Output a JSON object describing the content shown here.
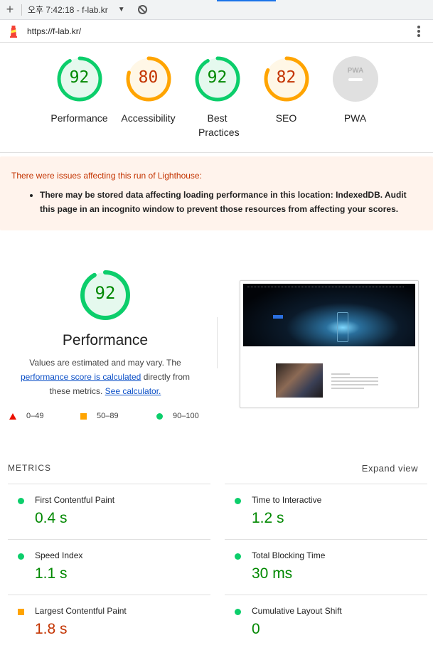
{
  "browser": {
    "tab_title": "오후 7:42:18 - f-lab.kr",
    "url": "https://f-lab.kr/"
  },
  "categories": [
    {
      "label": "Performance",
      "score": "92",
      "status": "pass",
      "fraction": 0.92
    },
    {
      "label": "Accessibility",
      "score": "80",
      "status": "average",
      "fraction": 0.8
    },
    {
      "label": "Best Practices",
      "score": "92",
      "status": "pass",
      "fraction": 0.92
    },
    {
      "label": "SEO",
      "score": "82",
      "status": "average",
      "fraction": 0.82
    },
    {
      "label": "PWA",
      "score": "",
      "status": "na",
      "fraction": 0
    }
  ],
  "warning": {
    "title": "There were issues affecting this run of Lighthouse:",
    "item": "There may be stored data affecting loading performance in this location: IndexedDB. Audit this page in an incognito window to prevent those resources from affecting your scores."
  },
  "performance": {
    "score": "92",
    "fraction": 0.92,
    "title": "Performance",
    "desc_pre": "Values are estimated and may vary. The ",
    "desc_link": "performance score is calculated",
    "desc_mid": " directly from these metrics. ",
    "desc_link2": "See calculator.",
    "legend": [
      "0–49",
      "50–89",
      "90–100"
    ]
  },
  "metrics": {
    "header": "METRICS",
    "expand": "Expand view",
    "items": [
      {
        "name": "First Contentful Paint",
        "value": "0.4 s",
        "status": "pass"
      },
      {
        "name": "Time to Interactive",
        "value": "1.2 s",
        "status": "pass"
      },
      {
        "name": "Speed Index",
        "value": "1.1 s",
        "status": "pass"
      },
      {
        "name": "Total Blocking Time",
        "value": "30 ms",
        "status": "pass"
      },
      {
        "name": "Largest Contentful Paint",
        "value": "1.8 s",
        "status": "average"
      },
      {
        "name": "Cumulative Layout Shift",
        "value": "0",
        "status": "pass"
      }
    ]
  },
  "colors": {
    "pass": "#0cce6b",
    "average": "#ffa400",
    "fail": "#eb0f00",
    "link": "#0c50c7"
  }
}
